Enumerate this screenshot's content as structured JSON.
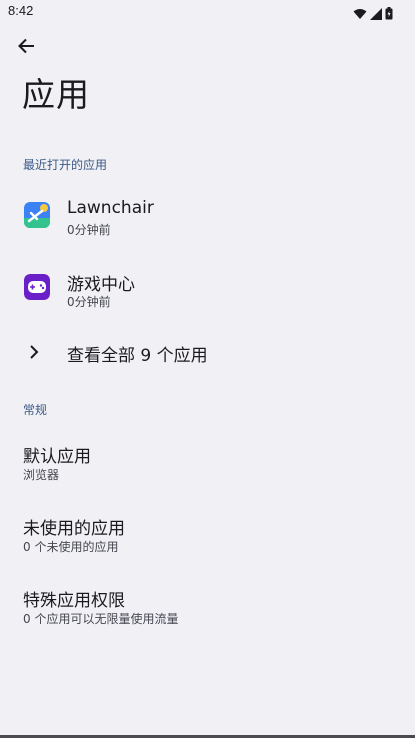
{
  "status_bar": {
    "time": "8:42",
    "icons": [
      "wifi-icon",
      "signal-icon",
      "battery-icon"
    ]
  },
  "header": {
    "back_icon": "arrow-back-icon",
    "title": "应用"
  },
  "recent_section": {
    "header": "最近打开的应用",
    "apps": [
      {
        "name": "Lawnchair",
        "time": "0分钟前",
        "icon": "lawnchair-icon"
      },
      {
        "name": "游戏中心",
        "time": "0分钟前",
        "icon": "game-center-icon"
      }
    ],
    "see_all_label": "查看全部 9 个应用"
  },
  "general_section": {
    "header": "常规",
    "items": [
      {
        "title": "默认应用",
        "subtitle": "浏览器"
      },
      {
        "title": "未使用的应用",
        "subtitle": "0 个未使用的应用"
      },
      {
        "title": "特殊应用权限",
        "subtitle": "0 个应用可以无限量使用流量"
      }
    ]
  },
  "colors": {
    "background": "#f1f0f5",
    "accent": "#3a5a87",
    "text": "#1b1b1f",
    "secondary_text": "#45464f"
  }
}
